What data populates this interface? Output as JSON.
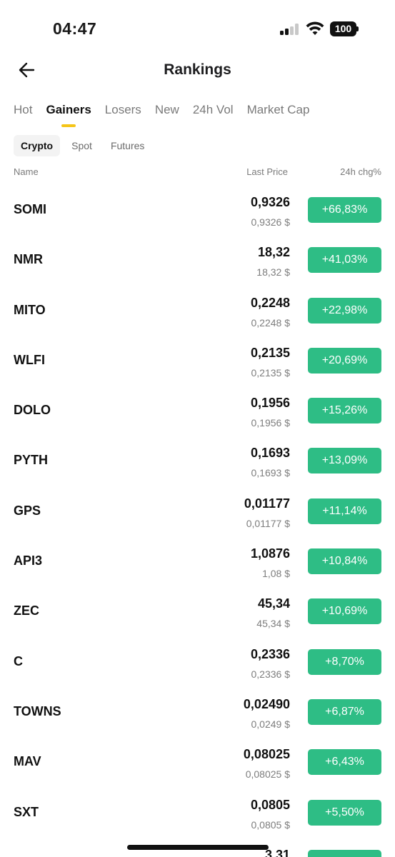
{
  "status_bar": {
    "time": "04:47",
    "battery": "100"
  },
  "header": {
    "title": "Rankings",
    "back_icon": "arrow-left-icon"
  },
  "tabs": [
    {
      "label": "Hot",
      "active": false
    },
    {
      "label": "Gainers",
      "active": true
    },
    {
      "label": "Losers",
      "active": false
    },
    {
      "label": "New",
      "active": false
    },
    {
      "label": "24h Vol",
      "active": false
    },
    {
      "label": "Market Cap",
      "active": false
    }
  ],
  "subtabs": [
    {
      "label": "Crypto",
      "active": true
    },
    {
      "label": "Spot",
      "active": false
    },
    {
      "label": "Futures",
      "active": false
    }
  ],
  "columns": {
    "name": "Name",
    "price": "Last Price",
    "change": "24h chg%"
  },
  "colors": {
    "gain": "#2ebd85",
    "accent": "#f5c518"
  },
  "rows": [
    {
      "symbol": "SOMI",
      "price": "0,9326",
      "price_usd": "0,9326 $",
      "change": "+66,83%"
    },
    {
      "symbol": "NMR",
      "price": "18,32",
      "price_usd": "18,32 $",
      "change": "+41,03%"
    },
    {
      "symbol": "MITO",
      "price": "0,2248",
      "price_usd": "0,2248 $",
      "change": "+22,98%"
    },
    {
      "symbol": "WLFI",
      "price": "0,2135",
      "price_usd": "0,2135 $",
      "change": "+20,69%"
    },
    {
      "symbol": "DOLO",
      "price": "0,1956",
      "price_usd": "0,1956 $",
      "change": "+15,26%"
    },
    {
      "symbol": "PYTH",
      "price": "0,1693",
      "price_usd": "0,1693 $",
      "change": "+13,09%"
    },
    {
      "symbol": "GPS",
      "price": "0,01177",
      "price_usd": "0,01177 $",
      "change": "+11,14%"
    },
    {
      "symbol": "API3",
      "price": "1,0876",
      "price_usd": "1,08 $",
      "change": "+10,84%"
    },
    {
      "symbol": "ZEC",
      "price": "45,34",
      "price_usd": "45,34 $",
      "change": "+10,69%"
    },
    {
      "symbol": "C",
      "price": "0,2336",
      "price_usd": "0,2336 $",
      "change": "+8,70%"
    },
    {
      "symbol": "TOWNS",
      "price": "0,02490",
      "price_usd": "0,0249 $",
      "change": "+6,87%"
    },
    {
      "symbol": "MAV",
      "price": "0,08025",
      "price_usd": "0,08025 $",
      "change": "+6,43%"
    },
    {
      "symbol": "SXT",
      "price": "0,0805",
      "price_usd": "0,0805 $",
      "change": "+5,50%"
    },
    {
      "symbol": "",
      "price": "3,31",
      "price_usd": "",
      "change": ""
    }
  ]
}
